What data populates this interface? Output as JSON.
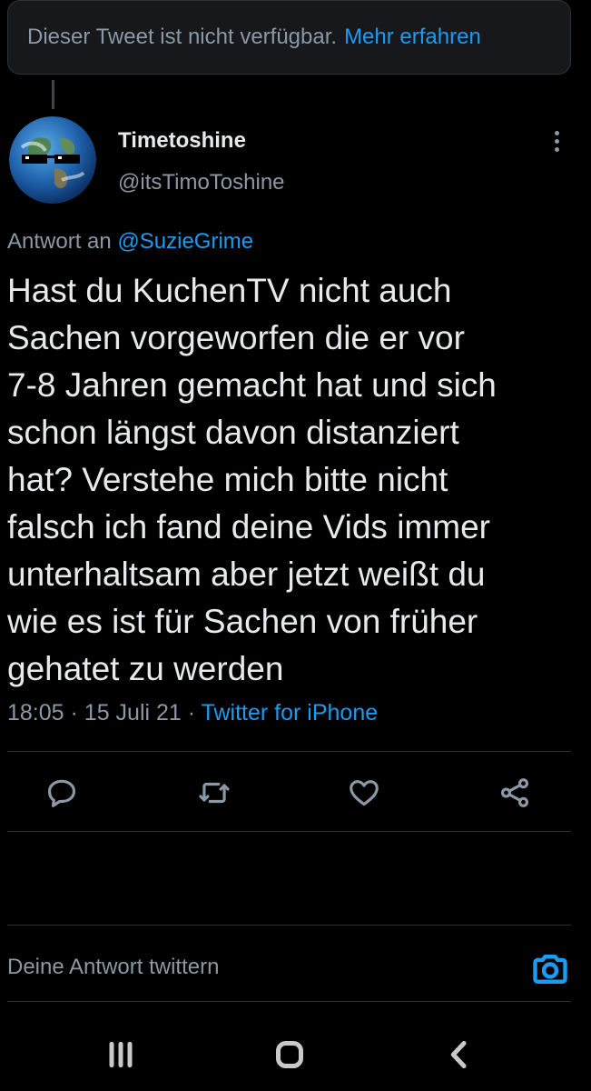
{
  "notice": {
    "text": "Dieser Tweet ist nicht verfügbar.",
    "link": "Mehr erfahren"
  },
  "author": {
    "display_name": "Timetoshine",
    "handle": "@itsTimoToshine",
    "avatar_icon": "earth-with-sunglasses-avatar"
  },
  "reply_to": {
    "prefix": "Antwort an",
    "mention": "@SuzieGrime"
  },
  "tweet": {
    "text": "Hast du KuchenTV nicht auch\nSachen vorgeworfen die er vor\n7-8 Jahren gemacht hat und sich\nschon längst davon distanziert\nhat? Verstehe mich bitte nicht\nfalsch ich fand deine Vids immer\nunterhaltsam aber jetzt weißt du\nwie es ist für Sachen von früher\ngehatet zu werden",
    "time": "18:05",
    "date": "15 Juli 21",
    "source": "Twitter for iPhone"
  },
  "actions": [
    "reply-icon",
    "retweet-icon",
    "like-icon",
    "share-icon"
  ],
  "compose": {
    "placeholder": "Deine Antwort twittern",
    "camera_icon": "camera-icon"
  },
  "system_nav": [
    "recent-apps-icon",
    "home-icon",
    "back-icon"
  ],
  "colors": {
    "background": "#000000",
    "accent": "#1d9bf0",
    "secondary_text": "#8b98a5",
    "primary_text": "#e7e9ea",
    "border": "#2f3336"
  }
}
